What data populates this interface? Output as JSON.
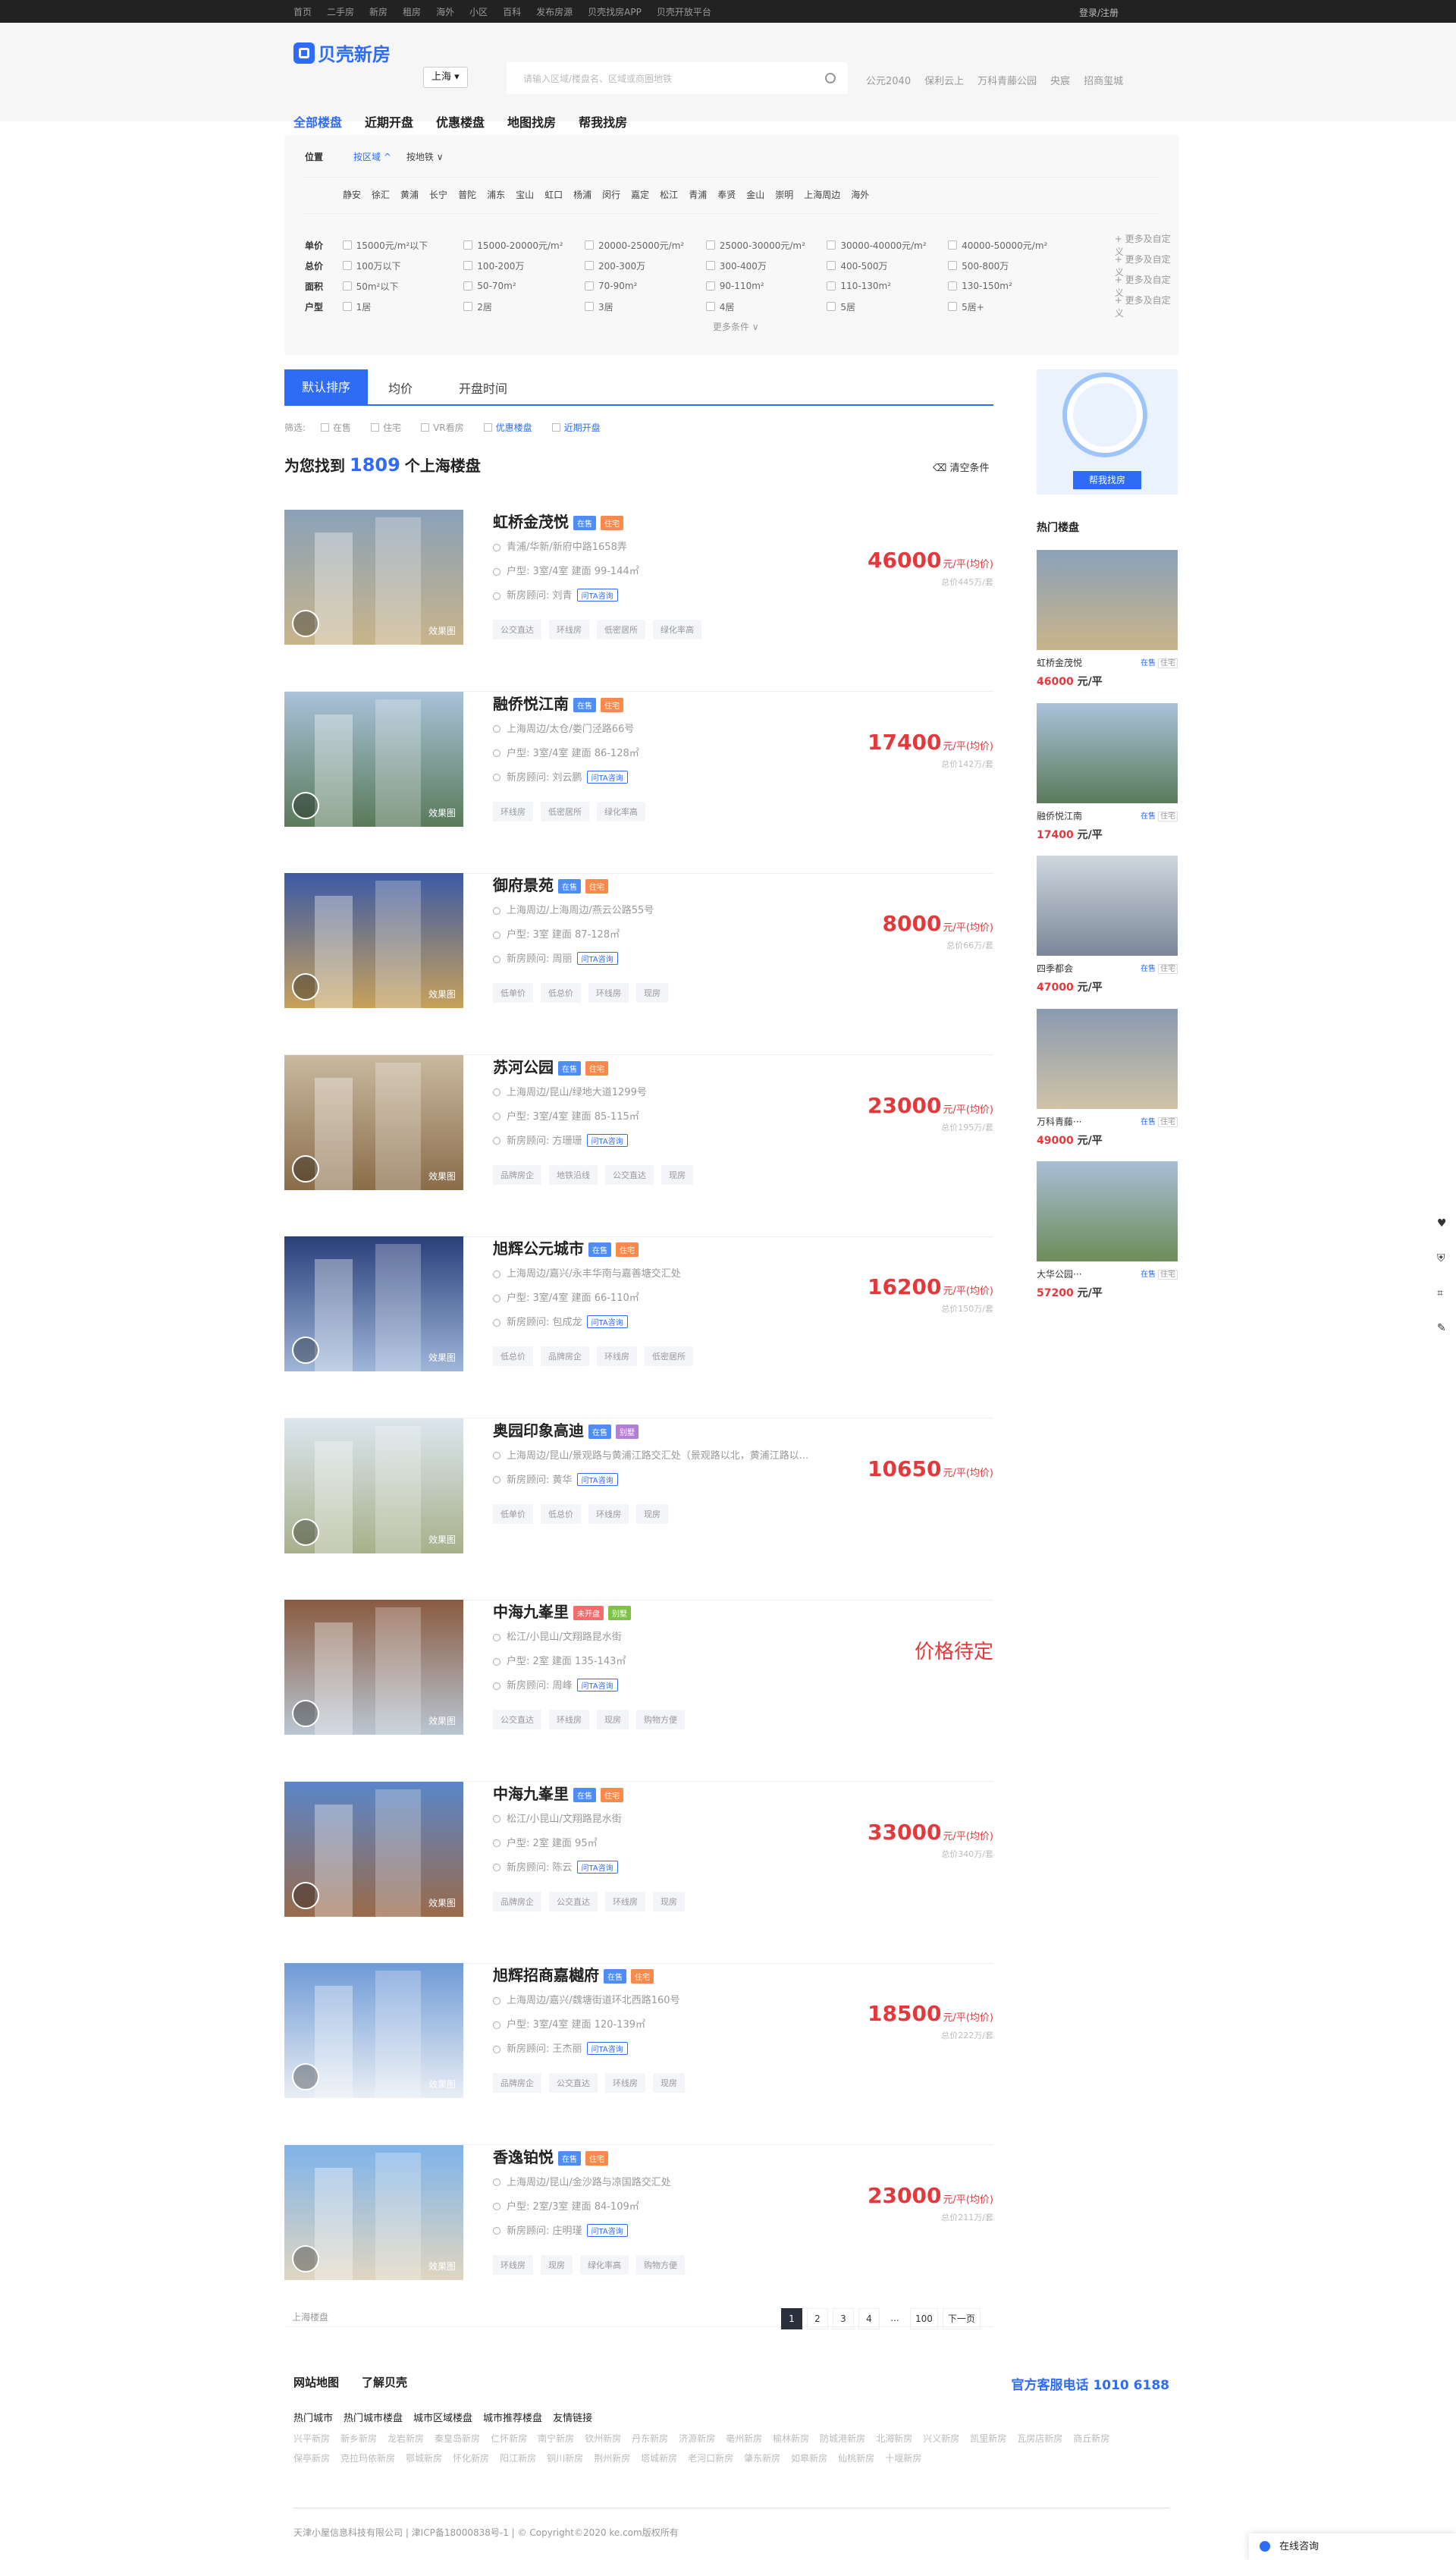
{
  "topnav": [
    "首页",
    "二手房",
    "新房",
    "租房",
    "海外",
    "小区",
    "百科",
    "发布房源",
    "贝壳找房APP",
    "贝壳开放平台"
  ],
  "login": "登录/注册",
  "logo_text": "贝壳新房",
  "city": "上海 ▾",
  "search_placeholder": "请输入区域/楼盘名、区域或商圈地铁",
  "hotlinks": [
    "公元2040",
    "保利云上",
    "万科青藤公园",
    "央宸",
    "招商玺城"
  ],
  "tabs": [
    "全部楼盘",
    "近期开盘",
    "优惠楼盘",
    "地图找房",
    "帮我找房"
  ],
  "filter": {
    "position_label": "位置",
    "by_district": "按区域 ^",
    "by_subway": "按地铁 ∨",
    "districts": [
      "静安",
      "徐汇",
      "黄浦",
      "长宁",
      "普陀",
      "浦东",
      "宝山",
      "虹口",
      "杨浦",
      "闵行",
      "嘉定",
      "松江",
      "青浦",
      "奉贤",
      "金山",
      "崇明",
      "上海周边",
      "海外"
    ],
    "rows": [
      {
        "label": "单价",
        "items": [
          "15000元/m²以下",
          "15000-20000元/m²",
          "20000-25000元/m²",
          "25000-30000元/m²",
          "30000-40000元/m²",
          "40000-50000元/m²"
        ]
      },
      {
        "label": "总价",
        "items": [
          "100万以下",
          "100-200万",
          "200-300万",
          "300-400万",
          "400-500万",
          "500-800万"
        ]
      },
      {
        "label": "面积",
        "items": [
          "50m²以下",
          "50-70m²",
          "70-90m²",
          "90-110m²",
          "110-130m²",
          "130-150m²"
        ]
      },
      {
        "label": "户型",
        "items": [
          "1居",
          "2居",
          "3居",
          "4居",
          "5居",
          "5居+"
        ]
      }
    ],
    "more_custom": "+ 更多及自定义",
    "more_conditions": "更多条件 ∨"
  },
  "sort_tabs": [
    "默认排序",
    "均价",
    "开盘时间"
  ],
  "screen_label": "筛选:",
  "screen_items": [
    "在售",
    "住宅",
    "VR看房",
    "优惠楼盘",
    "近期开盘"
  ],
  "found": {
    "pre": "为您找到",
    "num": "1809",
    "post": "个上海楼盘"
  },
  "clear": "清空条件",
  "effect_label": "效果图",
  "consult_label": "问TA咨询",
  "listings": [
    {
      "name": "虹桥金茂悦",
      "badges": [
        [
          "在售",
          "#4e8cf6"
        ],
        [
          "住宅",
          "#f98a4c"
        ]
      ],
      "addr": "青浦/华新/新府中路1658弄",
      "layout": "户型: 3室/4室    建面 99-144㎡",
      "agent": "新房顾问: 刘青",
      "tags": [
        "公交直达",
        "环线房",
        "低密居所",
        "绿化率高"
      ],
      "price": "46000",
      "unit": "元/平(均价)",
      "total": "总价445万/套",
      "c1": "#8aa1b9",
      "c2": "#c9b48a"
    },
    {
      "name": "融侨悦江南",
      "badges": [
        [
          "在售",
          "#4e8cf6"
        ],
        [
          "住宅",
          "#f98a4c"
        ]
      ],
      "addr": "上海周边/太仓/娄门泾路66号",
      "layout": "户型: 3室/4室    建面 86-128㎡",
      "agent": "新房顾问: 刘云鹏",
      "tags": [
        "环线房",
        "低密居所",
        "绿化率高"
      ],
      "price": "17400",
      "unit": "元/平(均价)",
      "total": "总价142万/套",
      "c1": "#a9c2da",
      "c2": "#5a7a5a"
    },
    {
      "name": "御府景苑",
      "badges": [
        [
          "在售",
          "#4e8cf6"
        ],
        [
          "住宅",
          "#f98a4c"
        ]
      ],
      "addr": "上海周边/上海周边/燕云公路55号",
      "layout": "户型: 3室    建面 87-128㎡",
      "agent": "新房顾问: 周丽",
      "tags": [
        "低单价",
        "低总价",
        "环线房",
        "现房"
      ],
      "price": "8000",
      "unit": "元/平(均价)",
      "total": "总价66万/套",
      "c1": "#3c5aa6",
      "c2": "#c7a15a"
    },
    {
      "name": "苏河公园",
      "badges": [
        [
          "在售",
          "#4e8cf6"
        ],
        [
          "住宅",
          "#f98a4c"
        ]
      ],
      "addr": "上海周边/昆山/绿地大道1299号",
      "layout": "户型: 3室/4室    建面 85-115㎡",
      "agent": "新房顾问: 方珊珊",
      "tags": [
        "品牌房企",
        "地铁沿线",
        "公交直达",
        "现房"
      ],
      "price": "23000",
      "unit": "元/平(均价)",
      "total": "总价195万/套",
      "c1": "#c9b9a0",
      "c2": "#8a6d4a"
    },
    {
      "name": "旭辉公元城市",
      "badges": [
        [
          "在售",
          "#4e8cf6"
        ],
        [
          "住宅",
          "#f98a4c"
        ]
      ],
      "addr": "上海周边/嘉兴/永丰华南与嘉善塘交汇处",
      "layout": "户型: 3室/4室    建面 66-110㎡",
      "agent": "新房顾问: 包成龙",
      "tags": [
        "低总价",
        "品牌房企",
        "环线房",
        "低密居所"
      ],
      "price": "16200",
      "unit": "元/平(均价)",
      "total": "总价150万/套",
      "c1": "#2a3f7a",
      "c2": "#9fb6d9"
    },
    {
      "name": "奥园印象高迪",
      "badges": [
        [
          "在售",
          "#4e8cf6"
        ],
        [
          "别墅",
          "#b37fd6"
        ]
      ],
      "addr": "上海周边/昆山/景观路与黄浦江路交汇处（景观路以北，黄浦江路以...",
      "layout": "",
      "agent": "新房顾问: 黄华",
      "tags": [
        "低单价",
        "低总价",
        "环线房",
        "现房"
      ],
      "price": "10650",
      "unit": "元/平(均价)",
      "total": "",
      "c1": "#dbe6ef",
      "c2": "#a8b08a"
    },
    {
      "name": "中海九峯里",
      "badges": [
        [
          "未开盘",
          "#f56c6c"
        ],
        [
          "别墅",
          "#7fc24a"
        ]
      ],
      "addr": "松江/小昆山/文翔路昆水街",
      "layout": "户型: 2室    建面 135-143㎡",
      "agent": "新房顾问: 周峰",
      "tags": [
        "公交直达",
        "环线房",
        "现房",
        "购物方便"
      ],
      "price": "",
      "pending": "价格待定",
      "c1": "#8a5a40",
      "c2": "#b9c6d3"
    },
    {
      "name": "中海九峯里",
      "badges": [
        [
          "在售",
          "#4e8cf6"
        ],
        [
          "住宅",
          "#f98a4c"
        ]
      ],
      "addr": "松江/小昆山/文翔路昆水街",
      "layout": "户型: 2室    建面 95㎡",
      "agent": "新房顾问: 陈云",
      "tags": [
        "品牌房企",
        "公交直达",
        "环线房",
        "现房"
      ],
      "price": "33000",
      "unit": "元/平(均价)",
      "total": "总价340万/套",
      "c1": "#5a86c9",
      "c2": "#9a6a4a"
    },
    {
      "name": "旭辉招商嘉樾府",
      "badges": [
        [
          "在售",
          "#4e8cf6"
        ],
        [
          "住宅",
          "#f98a4c"
        ]
      ],
      "addr": "上海周边/嘉兴/魏塘街道环北西路160号",
      "layout": "户型: 3室/4室    建面 120-139㎡",
      "agent": "新房顾问: 王杰丽",
      "tags": [
        "品牌房企",
        "公交直达",
        "环线房",
        "现房"
      ],
      "price": "18500",
      "unit": "元/平(均价)",
      "total": "总价222万/套",
      "c1": "#6f9ad6",
      "c2": "#e9eef4"
    },
    {
      "name": "香逸铂悦",
      "badges": [
        [
          "在售",
          "#4e8cf6"
        ],
        [
          "住宅",
          "#f98a4c"
        ]
      ],
      "addr": "上海周边/昆山/金沙路与凉国路交汇处",
      "layout": "户型: 2室/3室    建面 84-109㎡",
      "agent": "新房顾问: 庄明瑾",
      "tags": [
        "环线房",
        "现房",
        "绿化率高",
        "购物方便"
      ],
      "price": "23000",
      "unit": "元/平(均价)",
      "total": "总价211万/套",
      "c1": "#7fb3ea",
      "c2": "#e0d6c0"
    }
  ],
  "crumb": "上海楼盘",
  "pager": [
    "1",
    "2",
    "3",
    "4",
    "...",
    "100",
    "下一页"
  ],
  "side": {
    "ad_button": "帮我找房",
    "hot_title": "热门楼盘",
    "hot": [
      {
        "name": "虹桥金茂悦",
        "price": "46000",
        "c1": "#8aa1b9",
        "c2": "#c9b48a"
      },
      {
        "name": "融侨悦江南",
        "price": "17400",
        "c1": "#a9c2da",
        "c2": "#5a7a5a"
      },
      {
        "name": "四季都会",
        "price": "47000",
        "c1": "#cfd8e0",
        "c2": "#7a8696"
      },
      {
        "name": "万科青藤···",
        "price": "49000",
        "c1": "#8a9ab0",
        "c2": "#d0c3a8"
      },
      {
        "name": "大华公园···",
        "price": "57200",
        "c1": "#a8bed6",
        "c2": "#6c8d5a"
      }
    ],
    "hot_badge1": "在售",
    "hot_badge2": "住宅",
    "unit": "元/平"
  },
  "footer": {
    "top": [
      "网站地图",
      "了解贝壳"
    ],
    "phone": "官方客服电话 1010 6188",
    "links": [
      "热门城市",
      "热门城市楼盘",
      "城市区域楼盘",
      "城市推荐楼盘",
      "友情链接"
    ],
    "cities": [
      "兴平新房",
      "新乡新房",
      "龙岩新房",
      "秦皇岛新房",
      "仁怀新房",
      "南宁新房",
      "钦州新房",
      "丹东新房",
      "济源新房",
      "亳州新房",
      "榆林新房",
      "防城港新房",
      "北海新房",
      "兴义新房",
      "凯里新房",
      "瓦房店新房",
      "商丘新房",
      "保亭新房",
      "克拉玛依新房",
      "鄂城新房",
      "怀化新房",
      "阳江新房",
      "铜川新房",
      "荆州新房",
      "塔城新房",
      "老河口新房",
      "肇东新房",
      "如皋新房",
      "仙桃新房",
      "十堰新房"
    ],
    "copyright": "天津小屋信息科技有限公司 | 津ICP备18000838号-1 | © Copyright©2020 ke.com版权所有"
  },
  "chat": "在线咨询"
}
